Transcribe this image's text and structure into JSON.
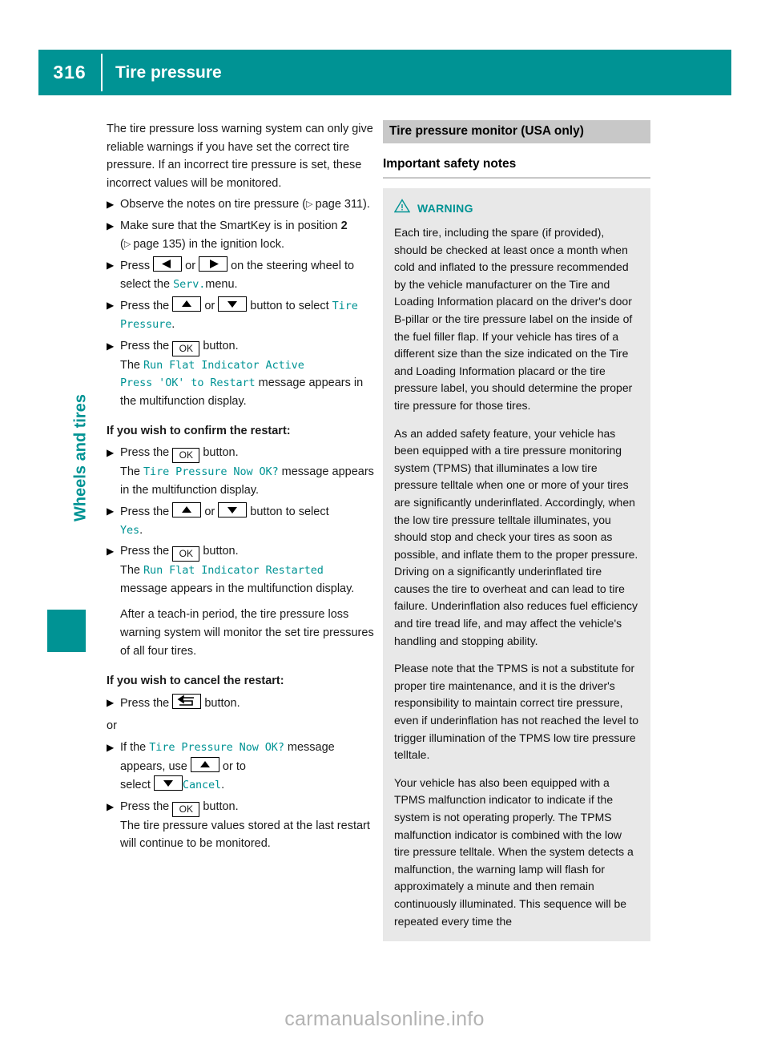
{
  "header": {
    "page_number": "316",
    "title": "Tire pressure",
    "accent_color": "#009394"
  },
  "side_tab": {
    "label": "Wheels and tires"
  },
  "left_column": {
    "intro_paragraph": "The tire pressure loss warning system can only give reliable warnings if you have set the correct tire pressure. If an incorrect tire pressure is set, these incorrect values will be monitored.",
    "steps": [
      {
        "prefix": "Observe the notes on tire pressure (",
        "pageref": "page 311",
        "suffix": ")."
      },
      {
        "prefix": "Make sure that the SmartKey is in position ",
        "bold": "2",
        "mid": " (",
        "pageref": "page 135",
        "suffix": ") in the ignition lock."
      }
    ],
    "step_press_lr": {
      "lead": "Press",
      "or": "or",
      "tail": "on the steering wheel to select the",
      "mfd": "Serv.",
      "end": "menu."
    },
    "step_press_ud": {
      "lead": "Press the",
      "or": "or",
      "tail": "button to select",
      "mfd": "Tire Pressure",
      "end": "."
    },
    "step_press_ok1": {
      "lead": "Press the",
      "key": "OK",
      "tail": "button.",
      "note_lead": "The",
      "mfd_line1": "Run Flat Indicator Active",
      "mfd_line2": "Press 'OK' to Restart",
      "note_tail": "message appears in the multifunction display."
    },
    "confirm_heading": "If you wish to confirm the restart:",
    "confirm_ok": {
      "lead": "Press the",
      "key": "OK",
      "tail": "button.",
      "note_lead": "The",
      "mfd": "Tire Pressure Now OK?",
      "note_tail": "message appears in the multifunction display."
    },
    "confirm_select_yes": {
      "lead": "Press the",
      "or": "or",
      "tail": "button to select",
      "mfd": "Yes",
      "end": "."
    },
    "confirm_ok2": {
      "lead": "Press the",
      "key": "OK",
      "tail": "button.",
      "note_lead": "The",
      "mfd": "Run Flat Indicator Restarted",
      "note_tail": "message appears in the multifunction display."
    },
    "teach_in_note": "After a teach-in period, the tire pressure loss warning system will monitor the set tire pressures of all four tires.",
    "cancel_heading": "If you wish to cancel the restart:",
    "cancel_back": {
      "lead": "Press the",
      "tail": "button."
    },
    "or_text": "or",
    "cancel_select": {
      "lead": "If the",
      "mfd": "Tire Pressure Now OK?",
      "mid": "message appears, use",
      "or_to": "or to",
      "select_word": "select",
      "mfd_cancel": "Cancel",
      "end": "."
    },
    "cancel_ok": {
      "lead": "Press the",
      "key": "OK",
      "tail": "button.",
      "note": "The tire pressure values stored at the last restart will continue to be monitored."
    }
  },
  "right_column": {
    "section_title": "Tire pressure monitor (USA only)",
    "sub_title": "Important safety notes",
    "warning": {
      "label": "WARNING",
      "icon": "warning-triangle-icon",
      "color": "#009394",
      "paragraphs": [
        "Each tire, including the spare (if provided), should be checked at least once a month when cold and inflated to the pressure recommended by the vehicle manufacturer on the Tire and Loading Information placard on the driver's door B-pillar or the tire pressure label on the inside of the fuel filler flap. If your vehicle has tires of a different size than the size indicated on the Tire and Loading Information placard or the tire pressure label, you should determine the proper tire pressure for those tires.",
        "As an added safety feature, your vehicle has been equipped with a tire pressure monitoring system (TPMS) that illuminates a low tire pressure telltale when one or more of your tires are significantly underinflated. Accordingly, when the low tire pressure telltale illuminates, you should stop and check your tires as soon as possible, and inflate them to the proper pressure. Driving on a significantly underinflated tire causes the tire to overheat and can lead to tire failure. Underinflation also reduces fuel efficiency and tire tread life, and may affect the vehicle's handling and stopping ability.",
        "Please note that the TPMS is not a substitute for proper tire maintenance, and it is the driver's responsibility to maintain correct tire pressure, even if underinflation has not reached the level to trigger illumination of the TPMS low tire pressure telltale.",
        "Your vehicle has also been equipped with a TPMS malfunction indicator to indicate if the system is not operating properly. The TPMS malfunction indicator is combined with the low tire pressure telltale. When the system detects a malfunction, the warning lamp will flash for approximately a minute and then remain continuously illuminated. This sequence will be repeated every time the"
      ]
    }
  },
  "footer": {
    "watermark": "carmanualsonline.info"
  }
}
